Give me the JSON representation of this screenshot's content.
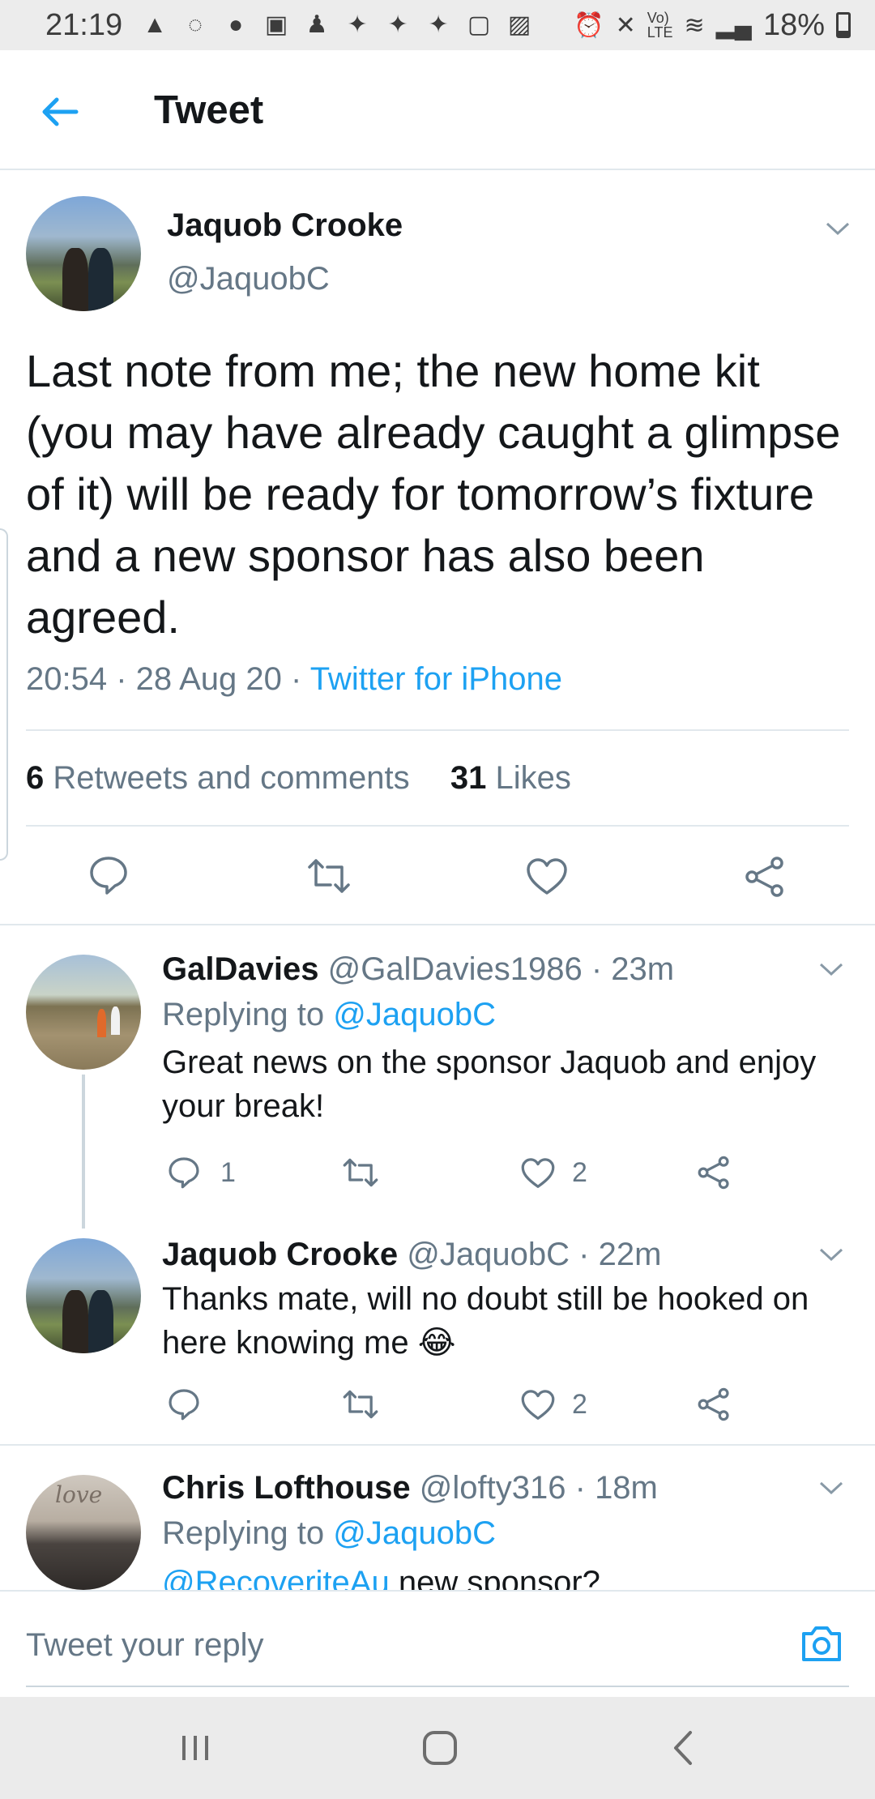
{
  "status_bar": {
    "time": "21:19",
    "battery": "18%",
    "notification_icons": [
      "alert-icon",
      "whatsapp-icon",
      "facebook-icon",
      "w-icon",
      "app-icon",
      "twitter-icon",
      "twitter-icon",
      "twitter-icon",
      "app-icon",
      "image-icon"
    ],
    "system_icons": [
      "alarm-icon",
      "mute-icon",
      "volte-icon",
      "wifi-icon",
      "signal-icon"
    ]
  },
  "header": {
    "title": "Tweet",
    "back_icon": "back-arrow-icon"
  },
  "main_tweet": {
    "author_name": "Jaquob Crooke",
    "author_handle": "@JaquobC",
    "text": "Last note from me; the new home kit (you may have already caught a glimpse of it) will be ready for tomorrow’s fixture and a new sponsor has also been agreed.",
    "time": "20:54",
    "date": "28 Aug 20",
    "source": "Twitter for iPhone",
    "retweets_count": "6",
    "retweets_label": "Retweets and comments",
    "likes_count": "31",
    "likes_label": "Likes"
  },
  "replies": [
    {
      "name": "GalDavies",
      "handle": "@GalDavies1986",
      "age": "23m",
      "replying_prefix": "Replying to",
      "replying_to": "@JaquobC",
      "text": "Great news on the sponsor Jaquob and enjoy your break!",
      "comment_count": "1",
      "like_count": "2"
    },
    {
      "name": "Jaquob Crooke",
      "handle": "@JaquobC",
      "age": "22m",
      "text": "Thanks mate, will no doubt still be hooked on here knowing me 😂",
      "comment_count": "",
      "like_count": "2"
    },
    {
      "name": "Chris Lofthouse",
      "handle": "@lofty316",
      "age": "18m",
      "replying_prefix": "Replying to",
      "replying_to": "@JaquobC",
      "mention": "@RecoveriteAu",
      "text": "new sponsor?",
      "avatar_text": "love"
    }
  ],
  "reply_bar": {
    "placeholder": "Tweet your reply",
    "camera_icon": "camera-icon"
  },
  "colors": {
    "accent": "#1da1f2",
    "muted": "#657786",
    "text": "#14171a",
    "divider": "#e1e8ed"
  }
}
